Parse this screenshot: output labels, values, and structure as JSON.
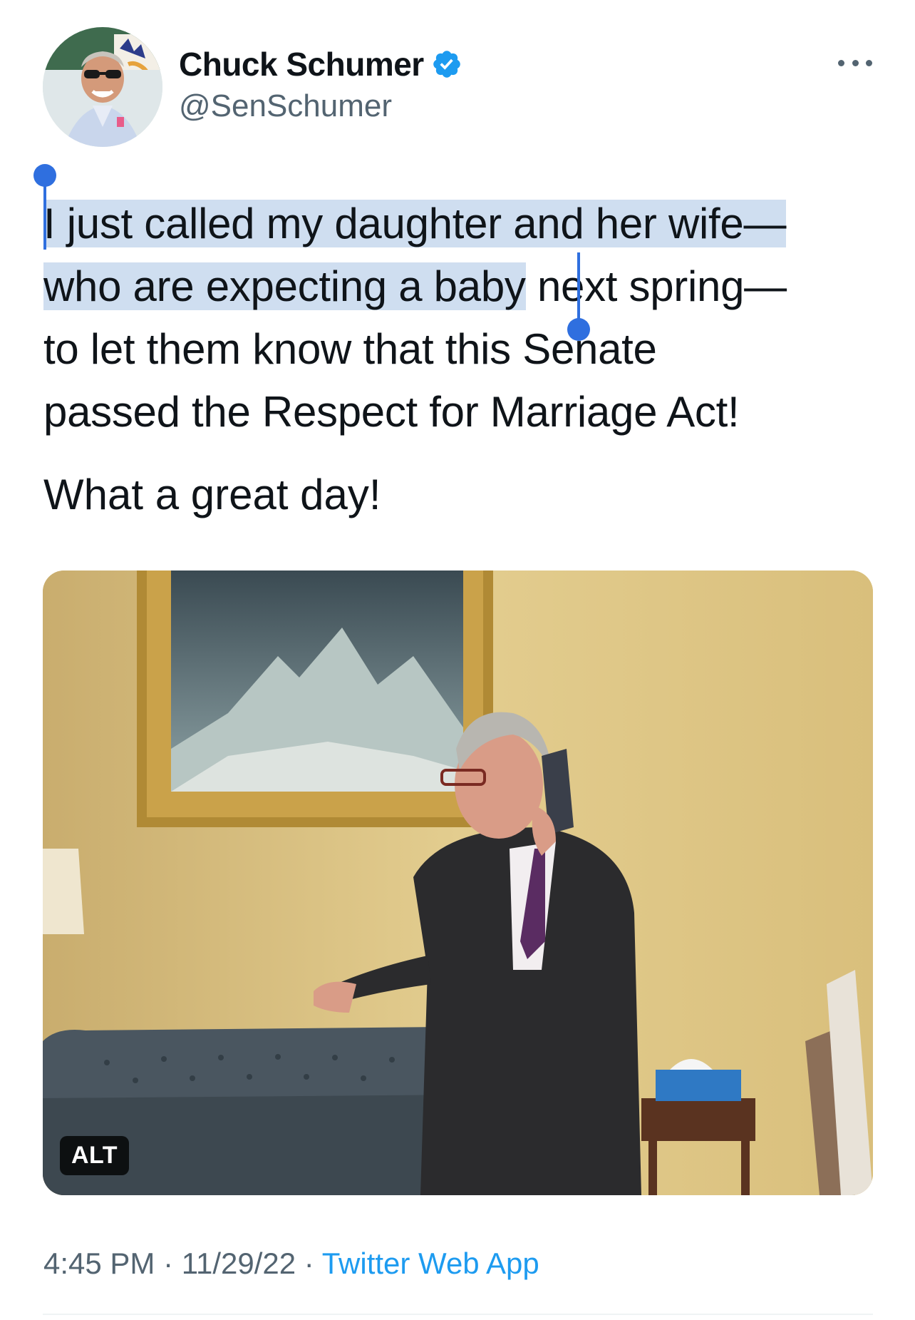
{
  "author": {
    "display_name": "Chuck Schumer",
    "handle": "@SenSchumer",
    "verified": true,
    "avatar_icon": "profile-photo"
  },
  "tweet": {
    "lines": [
      "I just called my daughter and her wife—",
      "who are expecting a baby",
      " next spring—",
      "to let them know that this Senate",
      "passed the Respect for Marriage Act!"
    ],
    "second_paragraph": "What a great day!",
    "selection_color": "#cfdef0"
  },
  "media": {
    "alt_label": "ALT"
  },
  "meta": {
    "time": "4:45 PM",
    "separator": " · ",
    "date": "11/29/22",
    "source": "Twitter Web App"
  },
  "colors": {
    "accent": "#1d9bf0",
    "selection_handle": "#2f6fdf",
    "secondary_text": "#536471"
  }
}
